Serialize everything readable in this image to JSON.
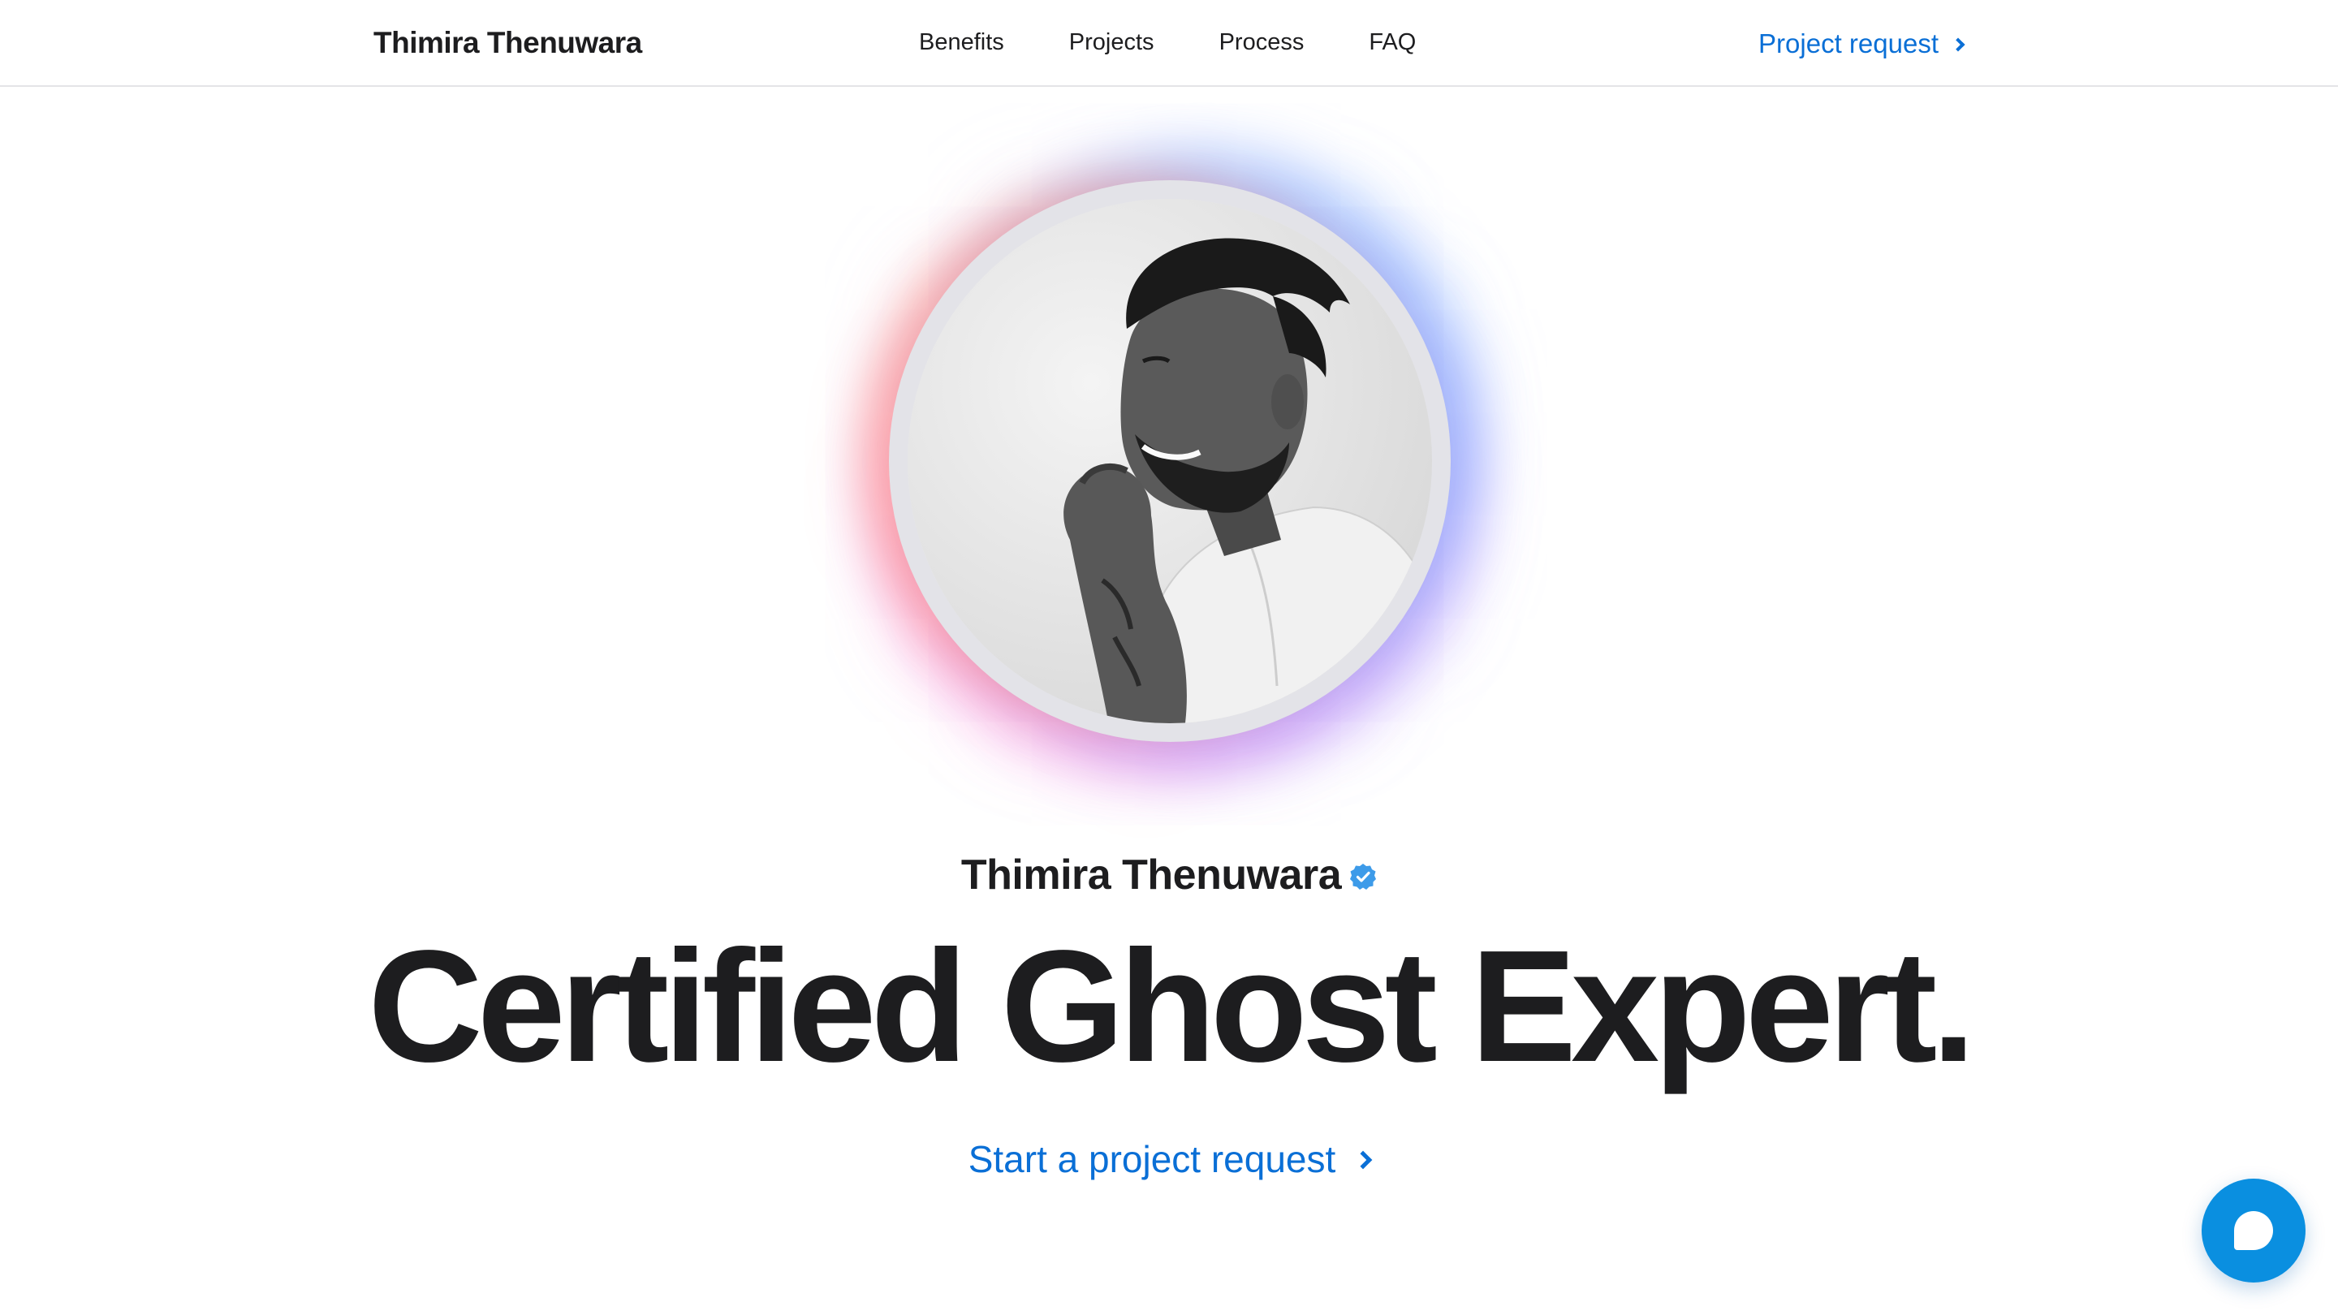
{
  "header": {
    "brand": "Thimira Thenuwara",
    "nav": [
      "Benefits",
      "Projects",
      "Process",
      "FAQ"
    ],
    "cta_label": "Project request"
  },
  "hero": {
    "avatar_icon": "portrait-photo",
    "name": "Thimira Thenuwara",
    "verified_icon": "verified-badge-icon",
    "headline": "Certified Ghost Expert.",
    "cta_label": "Start a project request"
  },
  "chat": {
    "icon": "chat-bubble-icon"
  },
  "colors": {
    "accent": "#0a6fd6",
    "text": "#1d1d1f",
    "chat_button": "#0a8fe0",
    "verified": "#3d9be9"
  }
}
